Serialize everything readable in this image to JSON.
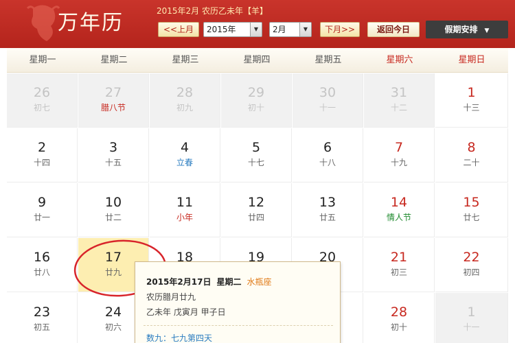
{
  "header": {
    "logo": "万年历",
    "info": "2015年2月 农历乙未年【羊】",
    "prev_month": "<<上月",
    "year_select": "2015年",
    "month_select": "2月",
    "next_month": "下月>>",
    "today_button": "返回今日",
    "holiday_button": "假期安排"
  },
  "weekdays": [
    "星期一",
    "星期二",
    "星期三",
    "星期四",
    "星期五",
    "星期六",
    "星期日"
  ],
  "days": [
    {
      "d": "26",
      "l": "初七",
      "other": true
    },
    {
      "d": "27",
      "l": "腊八节",
      "other": true,
      "lc": "red"
    },
    {
      "d": "28",
      "l": "初九",
      "other": true
    },
    {
      "d": "29",
      "l": "初十",
      "other": true
    },
    {
      "d": "30",
      "l": "十一",
      "other": true
    },
    {
      "d": "31",
      "l": "十二",
      "other": true
    },
    {
      "d": "1",
      "l": "十三",
      "we": true
    },
    {
      "d": "2",
      "l": "十四"
    },
    {
      "d": "3",
      "l": "十五"
    },
    {
      "d": "4",
      "l": "立春",
      "lc": "blue"
    },
    {
      "d": "5",
      "l": "十七"
    },
    {
      "d": "6",
      "l": "十八"
    },
    {
      "d": "7",
      "l": "十九",
      "we": true
    },
    {
      "d": "8",
      "l": "二十",
      "we": true
    },
    {
      "d": "9",
      "l": "廿一"
    },
    {
      "d": "10",
      "l": "廿二"
    },
    {
      "d": "11",
      "l": "小年",
      "lc": "red"
    },
    {
      "d": "12",
      "l": "廿四"
    },
    {
      "d": "13",
      "l": "廿五"
    },
    {
      "d": "14",
      "l": "情人节",
      "we": true,
      "lc": "green"
    },
    {
      "d": "15",
      "l": "廿七",
      "we": true
    },
    {
      "d": "16",
      "l": "廿八"
    },
    {
      "d": "17",
      "l": "廿九",
      "today": true
    },
    {
      "d": "18",
      "l": ""
    },
    {
      "d": "19",
      "l": ""
    },
    {
      "d": "20",
      "l": ""
    },
    {
      "d": "21",
      "l": "初三",
      "we": true
    },
    {
      "d": "22",
      "l": "初四",
      "we": true
    },
    {
      "d": "23",
      "l": "初五"
    },
    {
      "d": "24",
      "l": "初六"
    },
    {
      "d": "",
      "l": ""
    },
    {
      "d": "",
      "l": ""
    },
    {
      "d": "",
      "l": ""
    },
    {
      "d": "28",
      "l": "初十",
      "we": true
    },
    {
      "d": "1",
      "l": "十一",
      "other": true
    }
  ],
  "tooltip": {
    "date": "2015年2月17日",
    "weekday": "星期二",
    "zodiac": "水瓶座",
    "lunar": "农历腊月廿九",
    "ganzhi": "乙未年 戊寅月 甲子日",
    "note": "数九：七九第四天"
  },
  "colors": {
    "header_red": "#b4241c",
    "weekend_red": "#c7281f",
    "today_highlight": "#fdeeb1",
    "annotation_circle": "#d8242a"
  }
}
